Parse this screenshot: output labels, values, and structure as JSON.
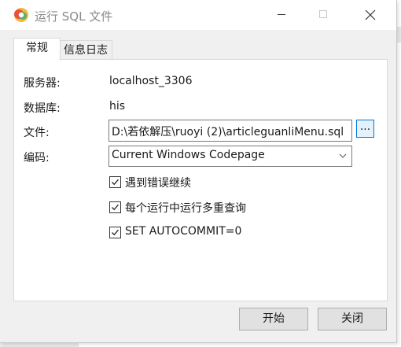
{
  "window": {
    "title": "运行 SQL 文件",
    "icon": "app-logo-icon"
  },
  "tabs": [
    {
      "label": "常规",
      "active": true
    },
    {
      "label": "信息日志",
      "active": false
    }
  ],
  "form": {
    "server_label": "服务器:",
    "server_value": "localhost_3306",
    "database_label": "数据库:",
    "database_value": "his",
    "file_label": "文件:",
    "file_value": "D:\\若依解压\\ruoyi (2)\\articleguanliMenu.sql",
    "browse_label": "...",
    "encoding_label": "编码:",
    "encoding_value": "Current Windows Codepage"
  },
  "options": [
    {
      "label": "遇到错误继续",
      "checked": true
    },
    {
      "label": "每个运行中运行多重查询",
      "checked": true
    },
    {
      "label": "SET AUTOCOMMIT=0",
      "checked": true
    }
  ],
  "buttons": {
    "start": "开始",
    "close": "关闭"
  },
  "colors": {
    "accent": "#0078d7",
    "dialog_bg": "#f0f0f0"
  }
}
